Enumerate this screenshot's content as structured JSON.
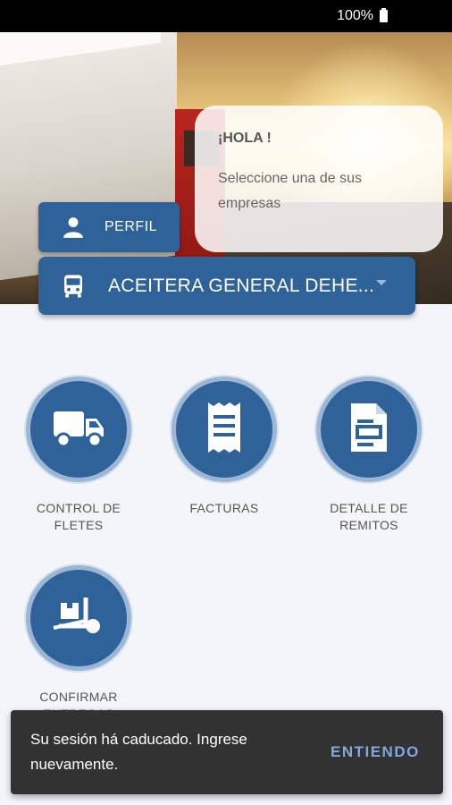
{
  "status_bar": {
    "battery": "100%"
  },
  "greeting": {
    "title": "¡HOLA !",
    "subtitle": "Seleccione una de sus empresas"
  },
  "perfil": {
    "label": "PERFIL",
    "icon": "person-icon"
  },
  "company_select": {
    "value": "ACEITERA GENERAL DEHE...",
    "icon": "bus-icon"
  },
  "tiles": [
    {
      "label": "CONTROL DE\nFLETES",
      "icon": "truck-icon"
    },
    {
      "label": "FACTURAS",
      "icon": "receipt-icon"
    },
    {
      "label": "DETALLE DE\nREMITOS",
      "icon": "document-icon"
    },
    {
      "label": "CONFIRMAR\nENTREGAS",
      "icon": "hand-truck-icon"
    }
  ],
  "snackbar": {
    "message": "Su sesión há caducado. Ingrese nuevamente.",
    "action": "ENTIENDO"
  },
  "colors": {
    "primary": "#2e6299",
    "circle_ring": "#9cb6d6",
    "snackbar_bg": "#323232",
    "snackbar_action": "#7fa8e0"
  }
}
